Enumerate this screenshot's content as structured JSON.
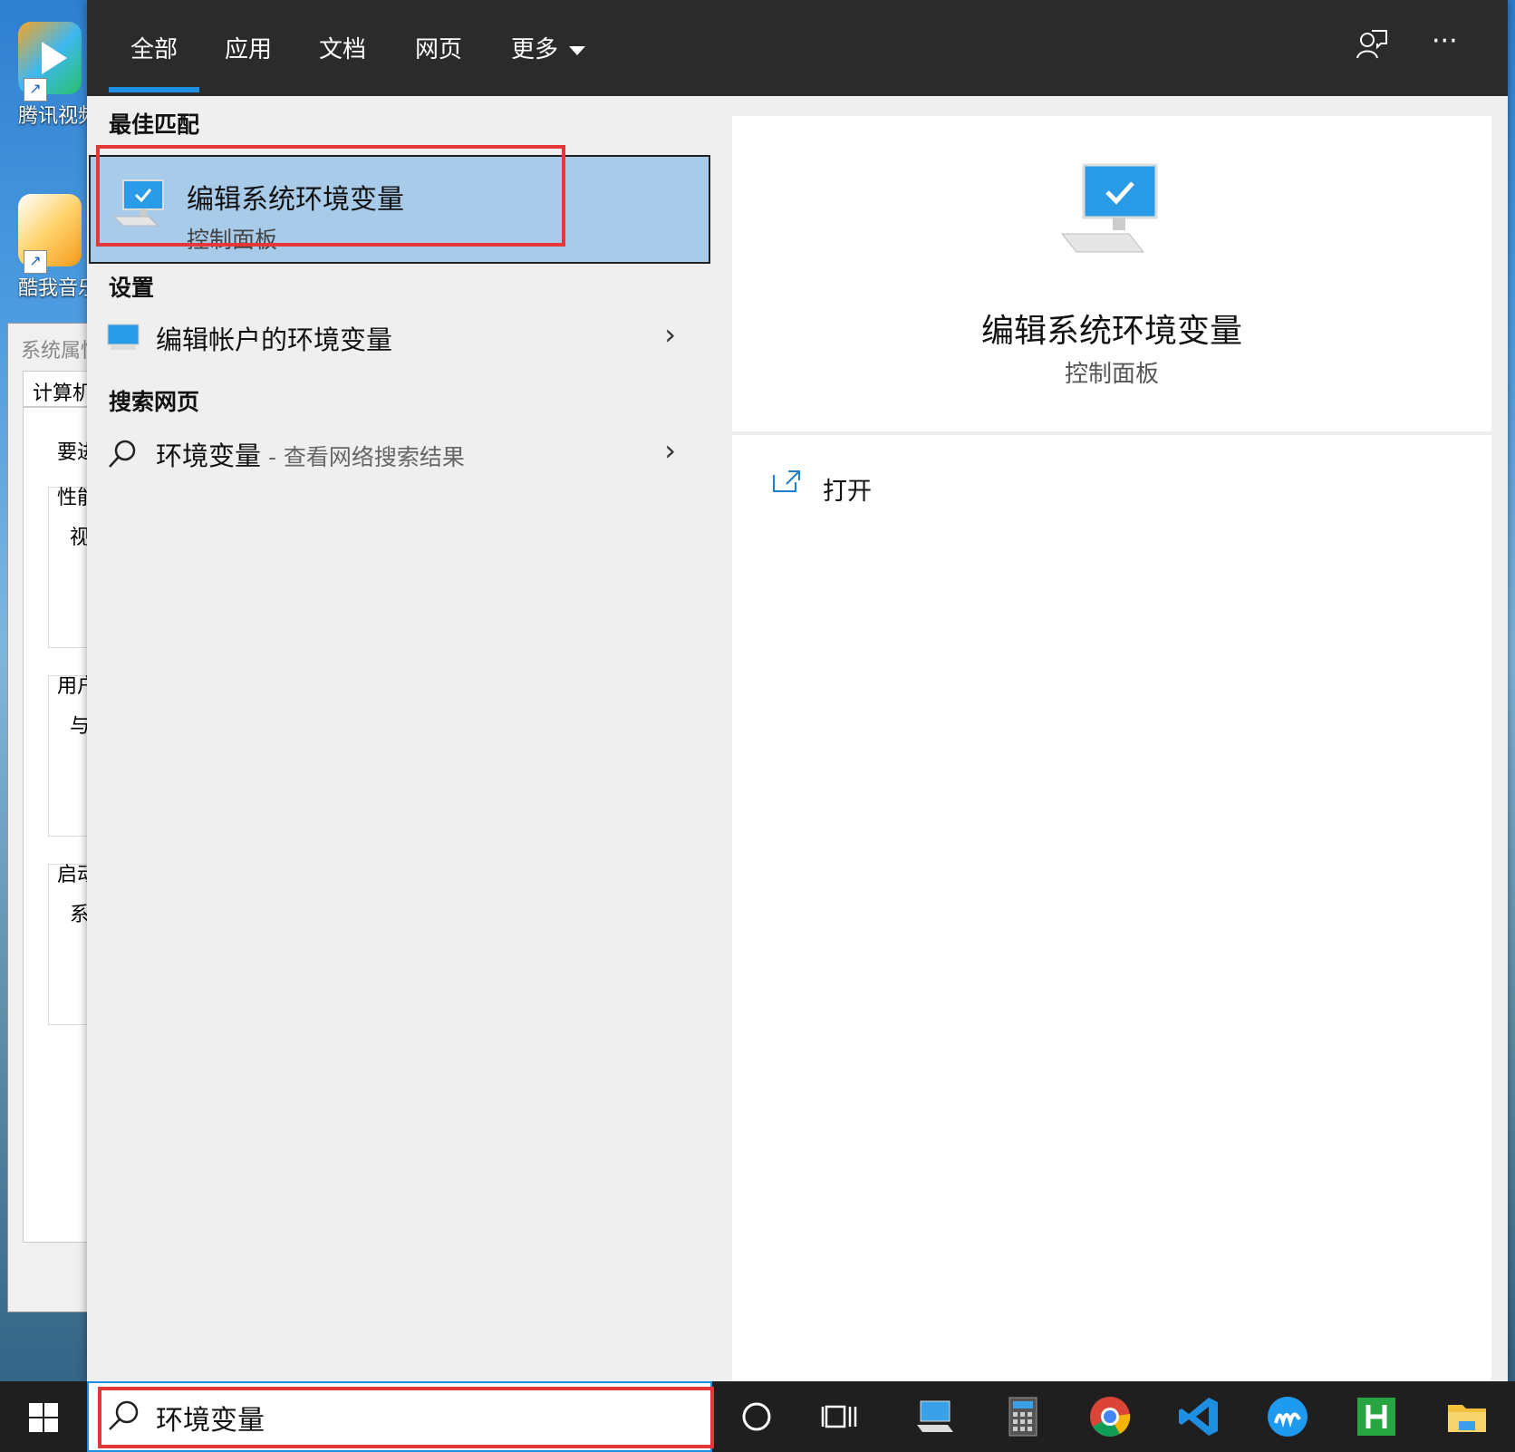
{
  "desktop": {
    "icons": [
      {
        "label": "腾讯视频"
      },
      {
        "label": "酷我音乐"
      }
    ],
    "system_properties_window": {
      "title": "系统属性",
      "tab": "计算机名",
      "rows": [
        "要进",
        "性能",
        "视",
        "用户",
        "与",
        "启动",
        "系"
      ]
    }
  },
  "search_panel": {
    "tabs": [
      {
        "label": "全部",
        "active": true
      },
      {
        "label": "应用"
      },
      {
        "label": "文档"
      },
      {
        "label": "网页"
      },
      {
        "label": "更多"
      }
    ],
    "top_right_icons": [
      "feedback-icon",
      "more-options-icon"
    ],
    "more_glyph": "···",
    "sections": {
      "best_match": {
        "title": "最佳匹配",
        "item": {
          "title": "编辑系统环境变量",
          "subtitle": "控制面板",
          "icon": "control-panel-monitor-icon"
        }
      },
      "settings": {
        "title": "设置",
        "item": {
          "label": "编辑帐户的环境变量",
          "icon": "settings-monitor-icon"
        }
      },
      "web": {
        "title": "搜索网页",
        "item": {
          "label": "环境变量",
          "suffix": " - 查看网络搜索结果",
          "icon": "search-icon"
        }
      }
    },
    "preview": {
      "name": "编辑系统环境变量",
      "category": "控制面板",
      "actions": [
        {
          "label": "打开",
          "icon": "open-external-icon"
        }
      ]
    }
  },
  "taskbar": {
    "search_value": "环境变量",
    "icons": [
      "cortana-icon",
      "task-view-icon",
      "remote-desktop-icon",
      "calculator-icon",
      "chrome-icon",
      "vscode-icon",
      "app-m-icon",
      "hbuilder-icon",
      "file-explorer-icon"
    ]
  },
  "colors": {
    "accent": "#1e8fe0",
    "selection": "#a8cbea",
    "highlight_box": "#e53737",
    "topbar": "#2b2b2b",
    "taskbar": "#1f1f1f"
  }
}
